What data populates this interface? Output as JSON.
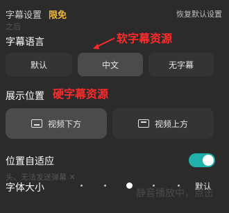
{
  "header": {
    "title": "字幕设置",
    "badge": "限免",
    "reset_label": "恢复默认设置",
    "ghost_bg": "之后"
  },
  "subtitle_language": {
    "label": "字幕语言",
    "options": [
      "默认",
      "中文",
      "无字幕"
    ],
    "selected": "中文"
  },
  "display_position": {
    "label": "展示位置",
    "options": [
      "视频下方",
      "视频上方"
    ],
    "selected": "视频下方"
  },
  "adaptive_position": {
    "label": "位置自适应",
    "enabled": true
  },
  "font_size": {
    "label": "字体大小",
    "value_label": "默认",
    "steps": 6,
    "selected_index": 3
  },
  "annotations": {
    "soft_subtitle": "软字幕资源",
    "hard_subtitle": "硬字幕资源"
  },
  "background_text": {
    "bottom_left": "头、无法发送弹幕 ✕",
    "bottom_right": "静音播放中，点击"
  },
  "colors": {
    "badge": "#f0b93a",
    "toggle_on": "#20b2aa",
    "annotation": "#ff2a2a"
  }
}
